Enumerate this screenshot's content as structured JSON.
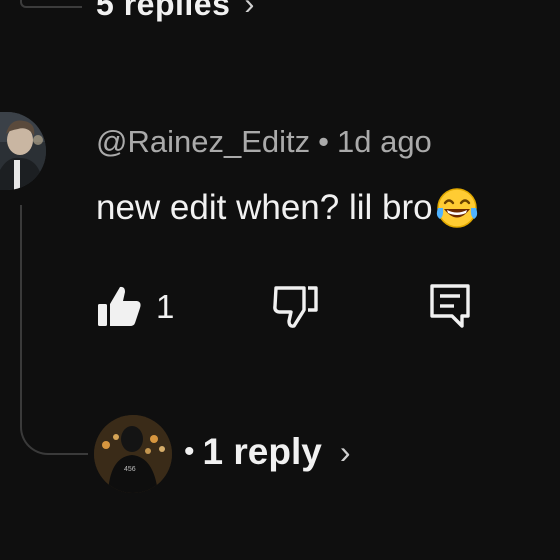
{
  "top_thread": {
    "replies_label": "5 replies",
    "chevron": "›"
  },
  "comment": {
    "author": "@Rainez_Editz",
    "separator": "•",
    "age": "1d ago",
    "text": "new edit when? lil bro",
    "emoji": "face-with-tears-of-joy",
    "like_count": "1"
  },
  "reply_thread": {
    "bullet": "•",
    "label": "1 reply",
    "chevron": "›"
  },
  "icons": {
    "like": "thumbs-up-filled-icon",
    "dislike": "thumbs-down-outline-icon",
    "reply": "comment-reply-icon"
  },
  "colors": {
    "background": "#0f0f0f",
    "primary_text": "#f1f1f1",
    "secondary_text": "#aaaaaa"
  }
}
